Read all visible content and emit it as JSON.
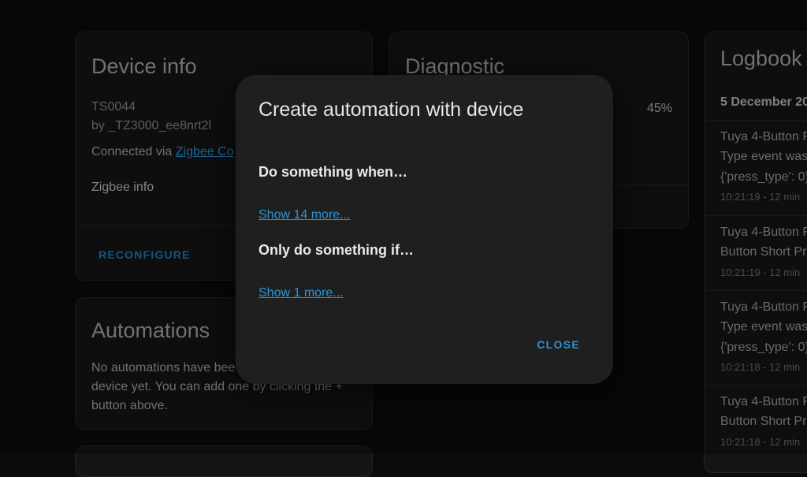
{
  "device_info": {
    "title": "Device info",
    "model": "TS0044",
    "manufacturer": "by _TZ3000_ee8nrt2l",
    "connected_prefix": "Connected via ",
    "connected_link": "Zigbee Co",
    "zigbee_info": "Zigbee info",
    "reconfigure_label": "RECONFIGURE"
  },
  "diagnostic": {
    "title": "Diagnostic",
    "value": "45%"
  },
  "automations": {
    "title": "Automations",
    "line1": "No automations have bee",
    "line2": "device yet. You can add one by clicking the +",
    "line3": "button above."
  },
  "logbook": {
    "title": "Logbook",
    "date": "5 December 20",
    "entries": [
      {
        "lines": [
          "Tuya 4-Button F",
          "Type event was",
          "{'press_type': 0}"
        ],
        "time": "10:21:19 - 12 min"
      },
      {
        "lines": [
          "Tuya 4-Button F",
          "Button Short Pr"
        ],
        "time": "10:21:19 - 12 min"
      },
      {
        "lines": [
          "Tuya 4-Button F",
          "Type event was",
          "{'press_type': 0}"
        ],
        "time": "10:21:18 - 12 min"
      },
      {
        "lines": [
          "Tuya 4-Button F",
          "Button Short Pr"
        ],
        "time": "10:21:18 - 12 min"
      }
    ]
  },
  "dialog": {
    "title": "Create automation with device",
    "trigger_heading": "Do something when…",
    "trigger_more": "Show 14 more...",
    "condition_heading": "Only do something if…",
    "condition_more": "Show 1 more...",
    "close_label": "CLOSE"
  }
}
